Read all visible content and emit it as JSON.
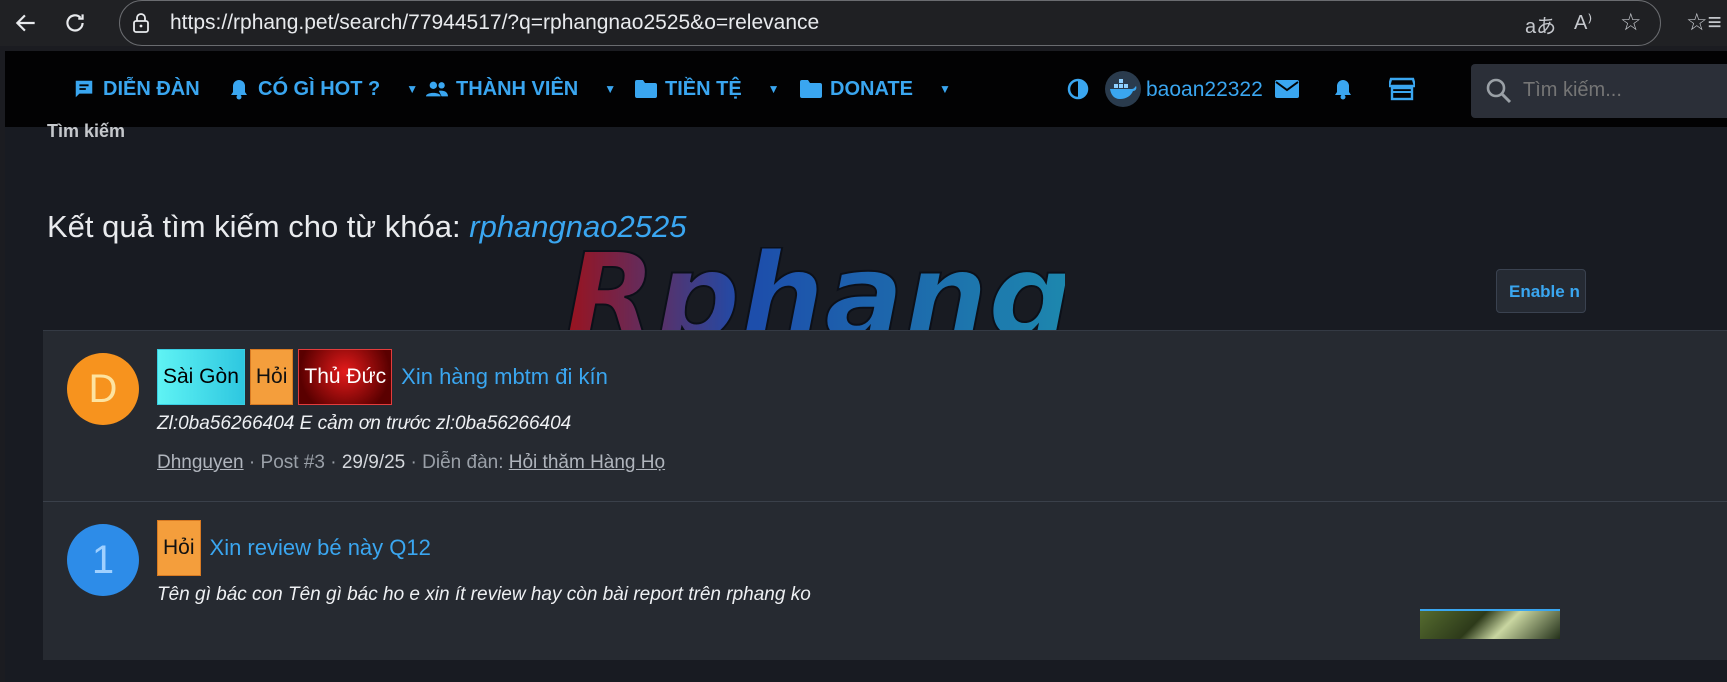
{
  "browser": {
    "url": "https://rphang.pet/search/77944517/?q=rphangnao2525&o=relevance"
  },
  "nav": {
    "items": [
      {
        "label": "DIỄN ĐÀN"
      },
      {
        "label": "CÓ GÌ HOT ?"
      },
      {
        "label": "THÀNH VIÊN"
      },
      {
        "label": "TIỀN TỆ"
      },
      {
        "label": "DONATE"
      }
    ],
    "username": "baoan22322",
    "search_placeholder": "Tìm kiếm..."
  },
  "breadcrumb": "Tìm kiếm",
  "heading": {
    "prefix": "Kết quả tìm kiếm cho từ khóa:",
    "keyword": "rphangnao2525"
  },
  "logo_text": "Rphang",
  "enable_button": "Enable n",
  "results": [
    {
      "avatar_letter": "D",
      "avatar_color": "#f7931e",
      "tags": [
        "Sài Gòn",
        "Hỏi",
        "Thủ Đức"
      ],
      "title": "Xin hàng mbtm đi kín",
      "snippet": "Zl:0ba56266404 E cảm ơn trước zl:0ba56266404",
      "meta": {
        "author": "Dhnguyen",
        "post": "Post #3",
        "date": "29/9/25",
        "forum_label": "Diễn đàn:",
        "forum": "Hỏi thăm Hàng Họ"
      }
    },
    {
      "avatar_letter": "1",
      "avatar_color": "#2d8ce8",
      "tags": [
        "Hỏi"
      ],
      "title": "Xin review bé này Q12",
      "snippet": "Tên gì bác con Tên gì bác ho e xin ít review hay còn bài report trên rphang ko"
    }
  ]
}
